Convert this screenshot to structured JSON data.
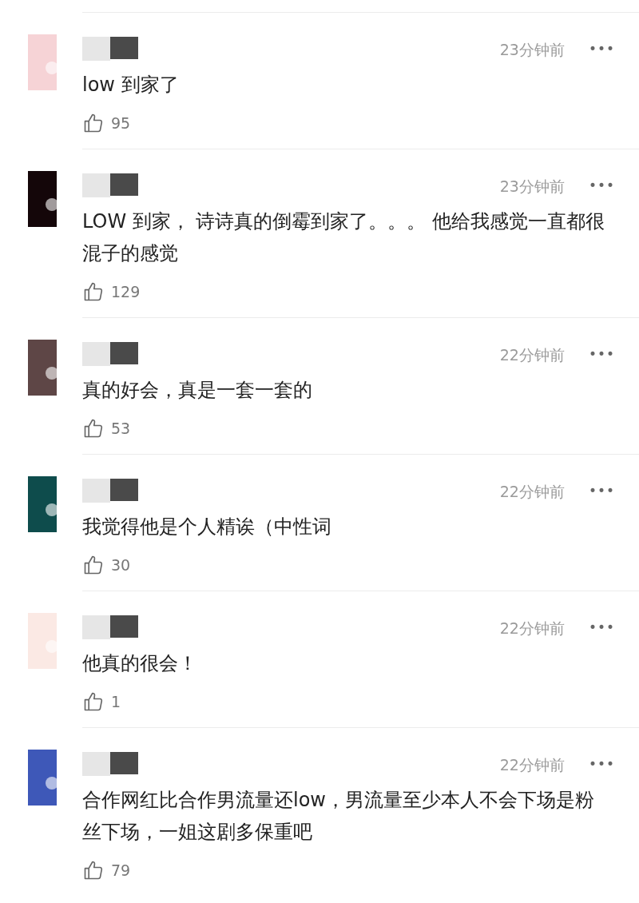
{
  "comments": [
    {
      "avatar": {
        "color": "#f6d3d6"
      },
      "time": "23分钟前",
      "more": "•••",
      "text": "low 到家了",
      "likes": "95"
    },
    {
      "avatar": {
        "color": "#140609"
      },
      "time": "23分钟前",
      "more": "•••",
      "text": "LOW 到家， 诗诗真的倒霉到家了。。。 他给我感觉一直都很混子的感觉",
      "likes": "129"
    },
    {
      "avatar": {
        "color": "#5e4646"
      },
      "time": "22分钟前",
      "more": "•••",
      "text": "真的好会，真是一套一套的",
      "likes": "53"
    },
    {
      "avatar": {
        "color": "#0e4c4c"
      },
      "time": "22分钟前",
      "more": "•••",
      "text": "我觉得他是个人精诶（中性词",
      "likes": "30"
    },
    {
      "avatar": {
        "color": "#fbe9e4"
      },
      "time": "22分钟前",
      "more": "•••",
      "text": "他真的很会！",
      "likes": "1"
    },
    {
      "avatar": {
        "color": "#3e58b8"
      },
      "time": "22分钟前",
      "more": "•••",
      "text": "合作网红比合作男流量还low，男流量至少本人不会下场是粉丝下场，一姐这剧多保重吧",
      "likes": "79"
    }
  ]
}
